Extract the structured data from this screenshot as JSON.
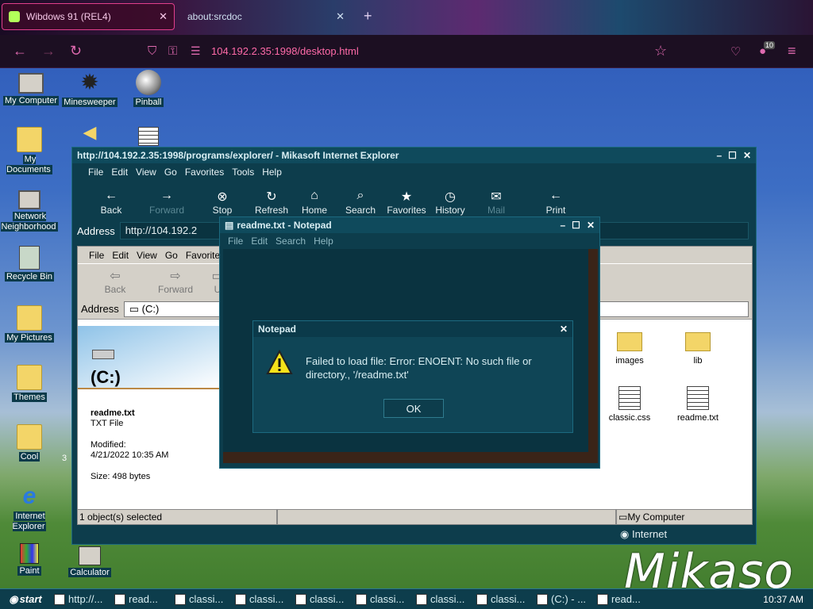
{
  "browser": {
    "tabs": [
      {
        "label": "Wibdows 91 (REL4)"
      },
      {
        "label": "about:srcdoc"
      }
    ],
    "url": "104.192.2.35:1998/desktop.html",
    "badge": "10"
  },
  "desktop_icons": [
    {
      "label": "My Computer"
    },
    {
      "label": "Minesweeper"
    },
    {
      "label": "Pinball"
    },
    {
      "label": "My Documents"
    },
    {
      "label": "Network Neighborhood"
    },
    {
      "label": "Recycle Bin"
    },
    {
      "label": "My Pictures"
    },
    {
      "label": "Themes"
    },
    {
      "label": "Cool"
    },
    {
      "label": "3"
    },
    {
      "label": "Internet Explorer"
    },
    {
      "label": "Paint"
    },
    {
      "label": "Calculator"
    }
  ],
  "ie": {
    "title": "http://104.192.2.35:1998/programs/explorer/ - Mikasoft Internet Explorer",
    "menu": [
      "File",
      "Edit",
      "View",
      "Go",
      "Favorites",
      "Tools",
      "Help"
    ],
    "toolbar": [
      {
        "label": "Back",
        "icon": "←"
      },
      {
        "label": "Forward",
        "icon": "→"
      },
      {
        "label": "Stop",
        "icon": "⊗"
      },
      {
        "label": "Refresh",
        "icon": "↻"
      },
      {
        "label": "Home",
        "icon": "⌂"
      },
      {
        "label": "Search",
        "icon": "⌕"
      },
      {
        "label": "Favorites",
        "icon": "★"
      },
      {
        "label": "History",
        "icon": "◷"
      },
      {
        "label": "Mail",
        "icon": "✉"
      },
      {
        "label": "Print",
        "icon": "←"
      }
    ],
    "address_label": "Address",
    "address_value": "http://104.192.2",
    "status_right": "Internet"
  },
  "explorer": {
    "menu": [
      "File",
      "Edit",
      "View",
      "Go",
      "Favorite"
    ],
    "toolbar": [
      {
        "label": "Back"
      },
      {
        "label": "Forward"
      },
      {
        "label": "U"
      }
    ],
    "address_label": "Address",
    "address_value": "(C:)",
    "drive_title": "(C:)",
    "file_name": "readme.txt",
    "file_type": "TXT File",
    "modified_label": "Modified:",
    "modified_value": "4/21/2022 10:35 AM",
    "size": "Size: 498 bytes",
    "files": [
      {
        "label": "images"
      },
      {
        "label": "lib"
      },
      {
        "label": "classic.css"
      },
      {
        "label": "readme.txt"
      }
    ],
    "status_left": "1 object(s) selected",
    "status_right": "My Computer"
  },
  "notepad": {
    "title": "readme.txt - Notepad",
    "menu": [
      "File",
      "Edit",
      "Search",
      "Help"
    ]
  },
  "dialog": {
    "title": "Notepad",
    "message": "Failed to load file: Error: ENOENT: No such file or directory., '/readme.txt'",
    "ok": "OK"
  },
  "logo": "Mikaso",
  "taskbar": {
    "start": "start",
    "items": [
      "http://...",
      "read...",
      "classi...",
      "classi...",
      "classi...",
      "classi...",
      "classi...",
      "classi...",
      "(C:) - ...",
      "read..."
    ],
    "clock": "10:37 AM"
  }
}
